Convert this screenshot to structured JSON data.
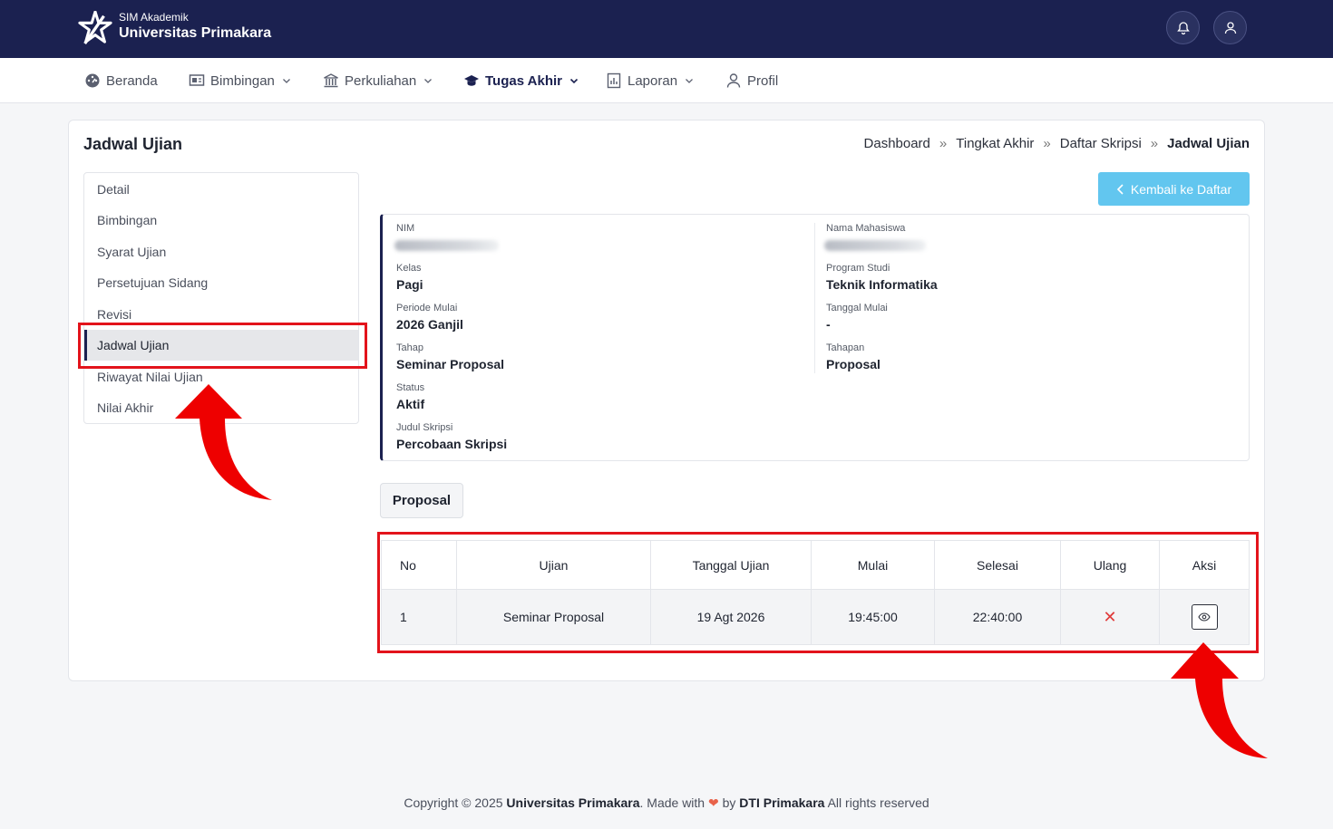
{
  "header": {
    "brand_sub": "SIM Akademik",
    "brand_main": "Universitas Primakara"
  },
  "nav": {
    "items": [
      {
        "label": "Beranda",
        "icon": "dashboard-icon",
        "dropdown": false
      },
      {
        "label": "Bimbingan",
        "icon": "presentation-icon",
        "dropdown": true
      },
      {
        "label": "Perkuliahan",
        "icon": "institution-icon",
        "dropdown": true
      },
      {
        "label": "Tugas Akhir",
        "icon": "graduation-cap-icon",
        "dropdown": true,
        "active": true
      },
      {
        "label": "Laporan",
        "icon": "report-icon",
        "dropdown": true
      },
      {
        "label": "Profil",
        "icon": "user-icon",
        "dropdown": false
      }
    ]
  },
  "page": {
    "title": "Jadwal Ujian",
    "breadcrumb": [
      "Dashboard",
      "Tingkat Akhir",
      "Daftar Skripsi",
      "Jadwal Ujian"
    ],
    "breadcrumb_sep": "»",
    "back_button": "Kembali ke Daftar"
  },
  "sidemenu": {
    "items": [
      "Detail",
      "Bimbingan",
      "Syarat Ujian",
      "Persetujuan Sidang",
      "Revisi",
      "Jadwal Ujian",
      "Riwayat Nilai Ujian",
      "Nilai Akhir"
    ],
    "active": "Jadwal Ujian"
  },
  "info": {
    "nim_label": "NIM",
    "nama_label": "Nama Mahasiswa",
    "kelas_label": "Kelas",
    "kelas": "Pagi",
    "prodi_label": "Program Studi",
    "prodi": "Teknik Informatika",
    "periode_label": "Periode Mulai",
    "periode": "2026 Ganjil",
    "tgl_mulai_label": "Tanggal Mulai",
    "tgl_mulai": "-",
    "tahap_label": "Tahap",
    "tahap": "Seminar Proposal",
    "tahapan_label": "Tahapan",
    "tahapan": "Proposal",
    "status_label": "Status",
    "status": "Aktif",
    "judul_label": "Judul Skripsi",
    "judul": "Percobaan Skripsi"
  },
  "tab": {
    "label": "Proposal"
  },
  "table": {
    "headers": [
      "No",
      "Ujian",
      "Tanggal Ujian",
      "Mulai",
      "Selesai",
      "Ulang",
      "Aksi"
    ],
    "rows": [
      {
        "no": "1",
        "ujian": "Seminar Proposal",
        "tanggal": "19 Agt 2026",
        "mulai": "19:45:00",
        "selesai": "22:40:00",
        "ulang": "✕",
        "aksi_icon": "eye-icon"
      }
    ]
  },
  "footer": {
    "prefix": "Copyright © 2025",
    "org": "Universitas Primakara",
    "made_with": ". Made with",
    "by": "by",
    "team": "DTI Primakara",
    "suffix": "All rights reserved"
  },
  "colors": {
    "topbar": "#1b2150",
    "accent_button": "#62c6ef",
    "highlight": "#e3131b",
    "arrow": "#ee0000"
  }
}
